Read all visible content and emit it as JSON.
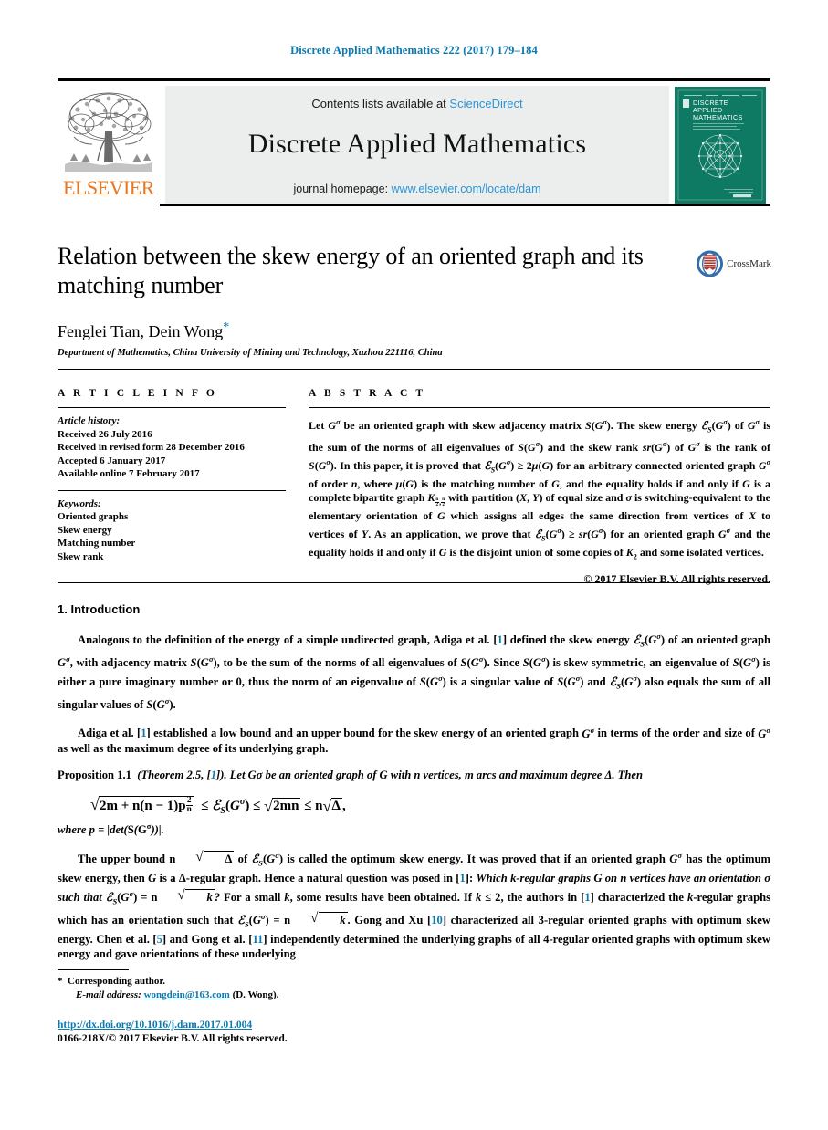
{
  "running_head": "Discrete Applied Mathematics 222 (2017) 179–184",
  "masthead": {
    "publisher_name": "ELSEVIER",
    "contents_prefix": "Contents lists available at ",
    "contents_link": "ScienceDirect",
    "journal_title": "Discrete Applied Mathematics",
    "homepage_prefix": "journal homepage: ",
    "homepage_link": "www.elsevier.com/locate/dam",
    "cover_line1": "DISCRETE",
    "cover_line2": "APPLIED",
    "cover_line3": "MATHEMATICS"
  },
  "article": {
    "title": "Relation between the skew energy of an oriented graph and its matching number",
    "authors": "Fenglei Tian, Dein Wong",
    "author_marker": "*",
    "affiliation": "Department of Mathematics, China University of Mining and Technology, Xuzhou 221116, China",
    "crossmark_label": "CrossMark"
  },
  "info": {
    "heading": "A R T I C L E   I N F O",
    "history_heading": "Article history:",
    "history": [
      "Received 26 July 2016",
      "Received in revised form 28 December 2016",
      "Accepted 6 January 2017",
      "Available online 7 February 2017"
    ],
    "keywords_heading": "Keywords:",
    "keywords": [
      "Oriented graphs",
      "Skew energy",
      "Matching number",
      "Skew rank"
    ]
  },
  "abstract": {
    "heading": "A B S T R A C T",
    "copyright": "© 2017 Elsevier B.V. All rights reserved."
  },
  "introduction": {
    "heading": "1.  Introduction"
  },
  "proposition": {
    "name": "Proposition 1.1",
    "source_open": "(Theorem 2.5, [",
    "source_ref": "1",
    "source_close": "]).",
    "statement": "Let Gσ be an oriented graph of G with n vertices, m arcs and maximum degree Δ. Then"
  },
  "footnote": {
    "star": "*",
    "corresponding": "Corresponding author.",
    "email_label": "E-mail address:",
    "email": "wongdein@163.com",
    "email_suffix": "(D. Wong).",
    "doi": "http://dx.doi.org/10.1016/j.dam.2017.01.004",
    "issn_line": "0166-218X/© 2017 Elsevier B.V. All rights reserved."
  },
  "colors": {
    "link": "#2b95d6",
    "ref": "#0b7ab0",
    "elsevier_orange": "#E87722",
    "cover_teal": "#0f7a63",
    "band_gray": "#eceded"
  }
}
